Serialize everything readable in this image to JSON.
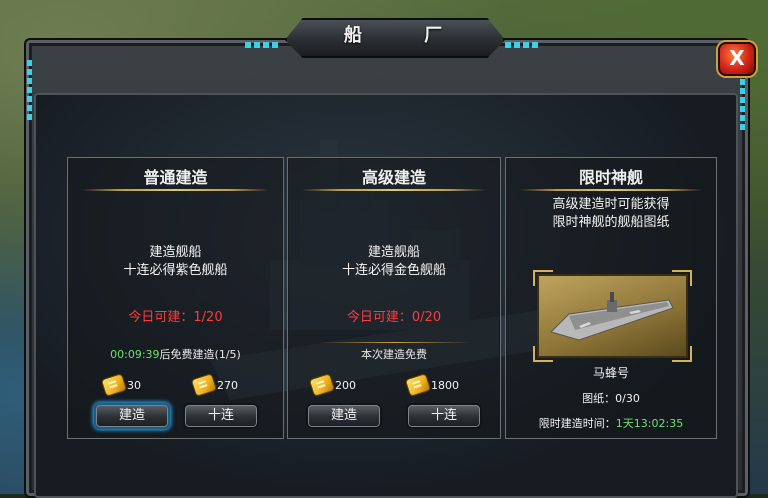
{
  "window": {
    "title": "船 厂",
    "close_label": "X"
  },
  "normal": {
    "title": "普通建造",
    "desc_line1": "建造舰船",
    "desc_line2": "十连必得紫色舰船",
    "today": "今日可建：1/20",
    "timer": "00:09:39",
    "timer_suffix": "后免费建造(1/5)",
    "cost_single": "30",
    "cost_ten": "270",
    "build_label": "建造",
    "ten_label": "十连"
  },
  "advanced": {
    "title": "高级建造",
    "desc_line1": "建造舰船",
    "desc_line2": "十连必得金色舰船",
    "today": "今日可建：0/20",
    "free_text": "本次建造免费",
    "cost_single": "200",
    "cost_ten": "1800",
    "build_label": "建造",
    "ten_label": "十连"
  },
  "limited": {
    "title": "限时神舰",
    "desc_line1": "高级建造时可能获得",
    "desc_line2": "限时神舰的舰船图纸",
    "ship_name": "马蜂号",
    "blueprint": "图纸：0/30",
    "time_label": "限时建造时间：",
    "time_value": "1天13:02:35"
  },
  "colors": {
    "accent": "#c9a23f",
    "warning": "#ff3b3b",
    "timer": "#6ee06e",
    "glow": "#2fb3ff"
  }
}
